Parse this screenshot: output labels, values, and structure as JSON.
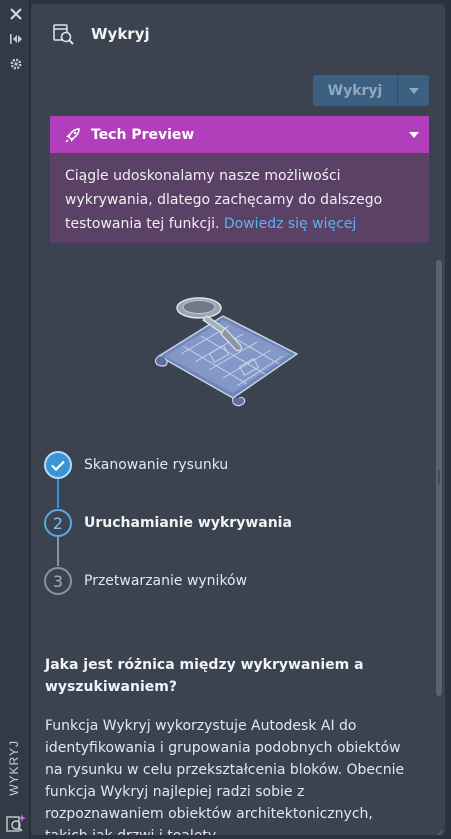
{
  "strip": {
    "close_icon": "close-icon",
    "vertical_label": "WYKRYJ"
  },
  "header": {
    "title": "Wykryj"
  },
  "toolbar": {
    "detect_label": "Wykryj"
  },
  "tech_preview": {
    "title": "Tech Preview",
    "body": "Ciągle udoskonalamy nasze możliwości wykrywania, dlatego zachęcamy do dalszego testowania tej funkcji.",
    "link": "Dowiedz się więcej"
  },
  "steps": [
    {
      "number": "1",
      "label": "Skanowanie rysunku",
      "state": "done"
    },
    {
      "number": "2",
      "label": "Uruchamianie wykrywania",
      "state": "active"
    },
    {
      "number": "3",
      "label": "Przetwarzanie wyników",
      "state": "pending"
    }
  ],
  "faq": {
    "question": "Jaka jest różnica między wykrywaniem a wyszukiwaniem?",
    "answer": "Funkcja Wykryj wykorzystuje Autodesk AI do identyfikowania i grupowania podobnych obiektów na rysunku w celu przekształcenia bloków. Obecnie funkcja Wykryj najlepiej radzi sobie z rozpoznawaniem obiektów architektonicznych, takich jak drzwi i toalety."
  },
  "colors": {
    "accent": "#3a95d6",
    "preview_header": "#b13fbb",
    "link": "#5ab4f0"
  }
}
